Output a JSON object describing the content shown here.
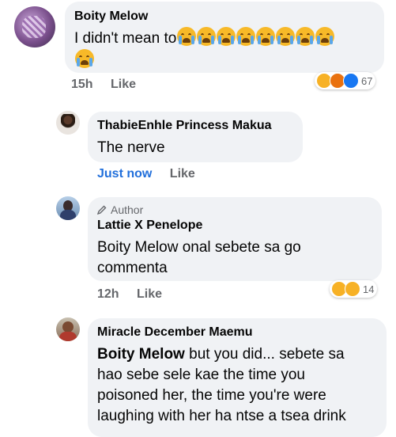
{
  "comments": [
    {
      "name": "Boity Melow",
      "text": "I didn't mean to",
      "emoji_count": 9,
      "time": "15h",
      "like": "Like",
      "reaction_icons": [
        "wow-icon",
        "angry-icon",
        "like-icon"
      ],
      "reaction_count": "67"
    },
    {
      "name": "ThabieEnhle Princess Makua",
      "text": "The nerve",
      "time": "Just now",
      "like": "Like"
    },
    {
      "badge": "Author",
      "name": "Lattie X Penelope",
      "text_line1": "Boity Melow onal sebete sa go",
      "text_line2": "commenta",
      "time": "12h",
      "like": "Like",
      "reaction_icons": [
        "sad-icon",
        "wow-icon"
      ],
      "reaction_count": "14"
    },
    {
      "name": "Miracle December Maemu",
      "mention": "Boity Melow",
      "text_line1": " but you did... sebete sa",
      "text_line2": "hao sebe sele kae the time you",
      "text_line3": "poisoned her, the time you're were",
      "text_line4": "laughing with her ha ntse a tsea drink"
    }
  ],
  "colors": {
    "bubble": "#f0f2f5",
    "meta": "#65676b",
    "just_now": "#216fdb",
    "emoji": "#f7b928"
  }
}
